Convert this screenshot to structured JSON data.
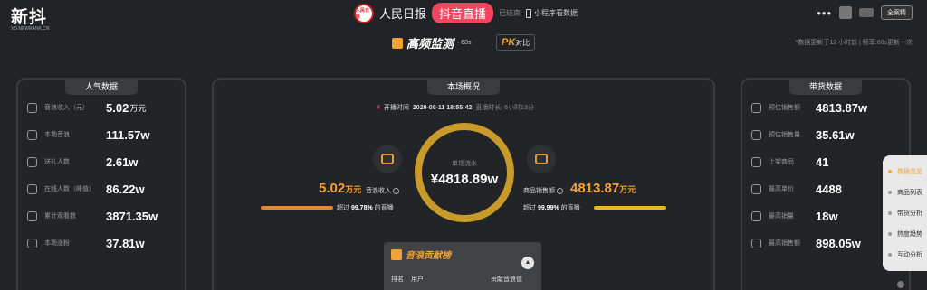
{
  "brand": {
    "logo_text": "新抖",
    "logo_sub": "XD.NEWRANK.CN"
  },
  "header": {
    "avatar_text": "人民日报",
    "anchor_name": "人民日报",
    "live_label": "抖音直播",
    "status": "已结束",
    "mini_program": "小程序看数据",
    "more": "•••",
    "vip_button": "全案精"
  },
  "monitor": {
    "title": "高频监测",
    "interval": "· 60s",
    "pk_main": "PK",
    "pk_sub": "对比"
  },
  "update_note": "*数据更新于12 小时前 | 频率:60s更新一次",
  "left_panel": {
    "title": "人气数据",
    "rows": [
      {
        "icon": "coins-icon",
        "label": "音浪收入（元）",
        "value": "5.02",
        "unit": "万元"
      },
      {
        "icon": "waveform-icon",
        "label": "本场音浪",
        "value": "111.57w",
        "unit": ""
      },
      {
        "icon": "gift-icon",
        "label": "送礼人数",
        "value": "2.61w",
        "unit": ""
      },
      {
        "icon": "users-icon",
        "label": "在线人数（峰值）",
        "value": "86.22w",
        "unit": ""
      },
      {
        "icon": "play-icon",
        "label": "累计观看数",
        "value": "3871.35w",
        "unit": ""
      },
      {
        "icon": "heart-icon",
        "label": "本场涨粉",
        "value": "37.81w",
        "unit": ""
      }
    ]
  },
  "center_panel": {
    "title": "本场概况",
    "hash": "#",
    "start_label": "开播时间",
    "start_time": "2020-08-11 18:55:42",
    "duration": "直播时长: 6小时13分",
    "ring_label": "单场流水",
    "ring_value": "¥4818.89w",
    "left_metric": {
      "value": "5.02",
      "unit": "万元",
      "caption": "音浪收入",
      "beat_prefix": "超过",
      "beat_pct": "99.78%",
      "beat_suffix": "的直播",
      "bar_fraction": 0.9978,
      "color": "#e9862f"
    },
    "right_metric": {
      "value": "4813.87",
      "unit": "万元",
      "caption": "商品销售额",
      "beat_prefix": "超过",
      "beat_pct": "99.99%",
      "beat_suffix": "的直播",
      "bar_fraction": 0.9999,
      "color": "#f0b429"
    }
  },
  "rank_panel": {
    "title": "音浪贡献榜",
    "col_rank": "排名",
    "col_user": "用户",
    "col_value": "贡献音浪值"
  },
  "right_panel": {
    "title": "带货数据",
    "rows": [
      {
        "icon": "bag-icon",
        "label": "预估销售额",
        "value": "4813.87w"
      },
      {
        "icon": "bar-chart-icon",
        "label": "预估销售量",
        "value": "35.61w"
      },
      {
        "icon": "shop-icon",
        "label": "上架商品",
        "value": "41"
      },
      {
        "icon": "yen-icon",
        "label": "最高单价",
        "value": "4488"
      },
      {
        "icon": "trend-icon",
        "label": "最高销量",
        "value": "18w"
      },
      {
        "icon": "yen-circle-icon",
        "label": "最高销售额",
        "value": "898.05w"
      }
    ]
  },
  "side_nav": {
    "items": [
      {
        "label": "数据总览",
        "active": true
      },
      {
        "label": "商品列表",
        "active": false
      },
      {
        "label": "带货分析",
        "active": false
      },
      {
        "label": "热度趋势",
        "active": false
      },
      {
        "label": "互动分析",
        "active": false
      }
    ]
  },
  "colors": {
    "accent": "#f3a336",
    "live": "#f2455f",
    "ring": "#c79a2a",
    "background": "#222326"
  }
}
